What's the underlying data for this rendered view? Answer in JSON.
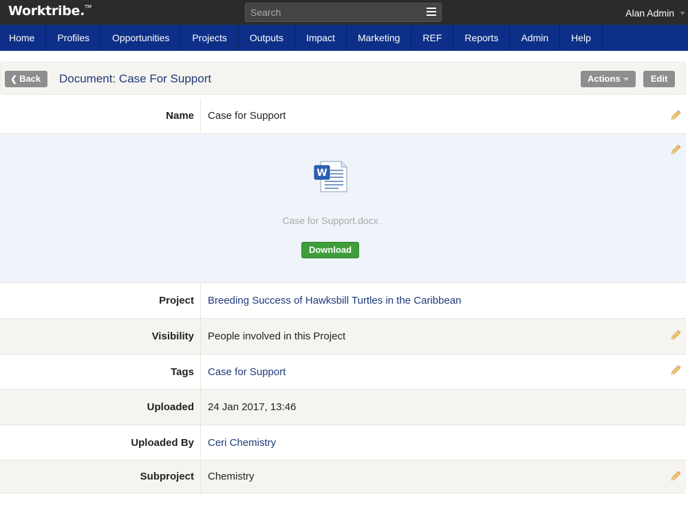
{
  "app": {
    "logo": "Worktribe.",
    "logo_tm": "TM"
  },
  "search": {
    "placeholder": "Search"
  },
  "user": {
    "name": "Alan Admin"
  },
  "nav": {
    "items": [
      "Home",
      "Profiles",
      "Opportunities",
      "Projects",
      "Outputs",
      "Impact",
      "Marketing",
      "REF",
      "Reports",
      "Admin",
      "Help"
    ]
  },
  "header": {
    "back_label": "Back",
    "title": "Document: Case For Support",
    "actions_label": "Actions",
    "edit_label": "Edit"
  },
  "document": {
    "file_name": "Case for Support.docx",
    "download_label": "Download",
    "file_icon": "word-document-icon"
  },
  "fields": {
    "name": {
      "label": "Name",
      "value": "Case for Support"
    },
    "project": {
      "label": "Project",
      "value": "Breeding Success of Hawksbill Turtles in the Caribbean"
    },
    "visibility": {
      "label": "Visibility",
      "value": "People involved in this Project"
    },
    "tags": {
      "label": "Tags",
      "value": "Case for Support"
    },
    "uploaded": {
      "label": "Uploaded",
      "value": "24 Jan 2017, 13:46"
    },
    "uploaded_by": {
      "label": "Uploaded By",
      "value": "Ceri Chemistry"
    },
    "subproject": {
      "label": "Subproject",
      "value": "Chemistry"
    }
  },
  "colors": {
    "nav": "#0d2f87",
    "topbar": "#2b2b2b",
    "link": "#1e3a78",
    "download": "#3e9e3a",
    "button": "#8e8e8e"
  }
}
